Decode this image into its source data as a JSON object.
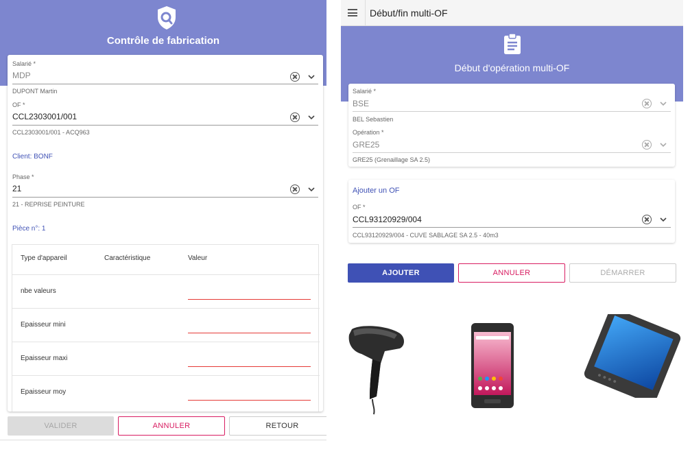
{
  "left": {
    "title": "Contrôle de fabrication",
    "salarie": {
      "label": "Salarié *",
      "value": "MDP",
      "sub": "DUPONT Martin"
    },
    "of": {
      "label": "OF *",
      "value": "CCL2303001/001",
      "sub": "CCL2303001/001 - ACQ963"
    },
    "client": "Client: BONF",
    "phase": {
      "label": "Phase *",
      "value": "21",
      "sub": "21 - REPRISE PEINTURE"
    },
    "piece": "Pièce n°: 1",
    "table": {
      "headers": [
        "Type d'appareil",
        "Caractéristique",
        "Valeur"
      ],
      "rows": [
        "nbe valeurs",
        "Epaisseur mini",
        "Epaisseur maxi",
        "Epaisseur moy"
      ]
    },
    "buttons": {
      "valider": "VALIDER",
      "annuler": "ANNULER",
      "retour": "RETOUR"
    },
    "icon": "search-shield-icon"
  },
  "right": {
    "topbar_title": "Début/fin multi-OF",
    "title": "Début d'opération multi-OF",
    "salarie": {
      "label": "Salarié *",
      "value": "BSE",
      "sub": "BEL Sebastien"
    },
    "operation": {
      "label": "Opération *",
      "value": "GRE25",
      "sub": "GRE25 (Grenaillage SA 2.5)"
    },
    "add_of": {
      "title": "Ajouter un OF",
      "label": "OF *",
      "value": "CCL93120929/004",
      "sub": "CCL93120929/004 - CUVE SABLAGE SA 2.5 - 40m3"
    },
    "buttons": {
      "ajouter": "AJOUTER",
      "annuler": "ANNULER",
      "demarrer": "DÉMARRER"
    },
    "icon": "clipboard-icon"
  },
  "devices": [
    "barcode-scanner",
    "android-handheld",
    "rugged-tablet"
  ],
  "colors": {
    "banner": "#7d86cf",
    "primary": "#3f51b5",
    "danger": "#d81b60",
    "error_line": "#e53935"
  }
}
